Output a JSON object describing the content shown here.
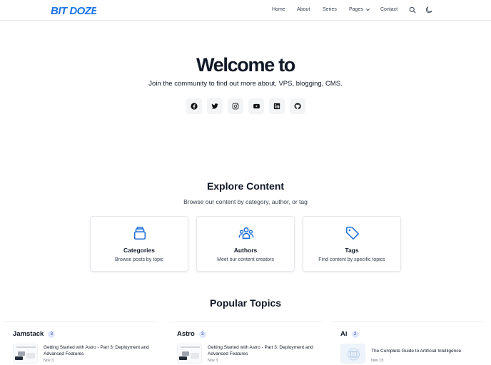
{
  "header": {
    "logo": "BIT DOZE",
    "nav": [
      "Home",
      "About",
      "Series",
      "Pages",
      "Contact"
    ],
    "icons": [
      "search-icon",
      "moon-icon"
    ]
  },
  "hero": {
    "title": "Welcome to",
    "subtitle": "Join the community to find out more about, VPS, blogging, CMS.",
    "socials": [
      "facebook-icon",
      "twitter-icon",
      "instagram-icon",
      "youtube-icon",
      "linkedin-icon",
      "github-icon"
    ]
  },
  "explore": {
    "title": "Explore Content",
    "subtitle": "Browse our content by category, author, or tag",
    "cards": [
      {
        "title": "Categories",
        "desc": "Browse posts by topic",
        "icon": "categories-icon"
      },
      {
        "title": "Authors",
        "desc": "Meet our content creators",
        "icon": "authors-icon"
      },
      {
        "title": "Tags",
        "desc": "Find content by specific topics",
        "icon": "tag-icon"
      }
    ]
  },
  "popular": {
    "title": "Popular Topics",
    "topics": [
      {
        "name": "Jamstack",
        "count": "3",
        "post_title": "Getting Started with Astro - Part 3: Deployment and Advanced Features",
        "post_date": "Nov 3"
      },
      {
        "name": "Astro",
        "count": "3",
        "post_title": "Getting Started with Astro - Part 3: Deployment and Advanced Features",
        "post_date": "Nov 3"
      },
      {
        "name": "Ai",
        "count": "2",
        "post_title": "The Complete Guide to Artificial Intelligence",
        "post_date": "Nov 15"
      }
    ]
  },
  "colors": {
    "accent": "#1d6fd6",
    "logo_blue": "#1a73e8",
    "text": "#111827",
    "muted": "#374151"
  }
}
